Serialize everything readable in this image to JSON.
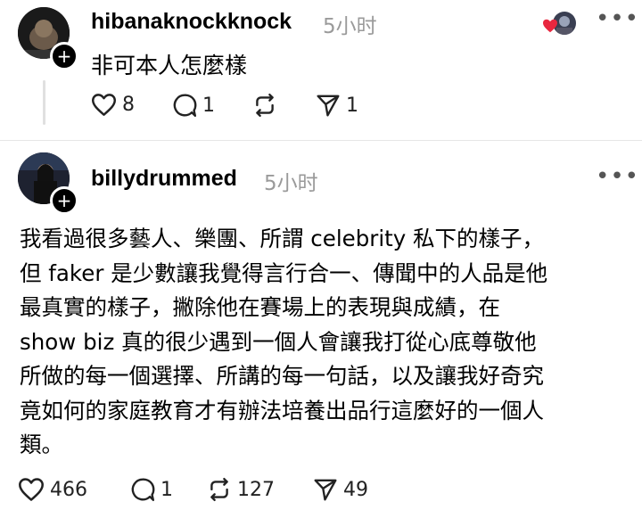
{
  "post1": {
    "username": "hibanaknockknock",
    "time": "5小时",
    "text": "非可本人怎麼樣",
    "likes": "8",
    "replies": "1",
    "reposts": "",
    "shares": "1",
    "more_icon": "more-icon"
  },
  "post2": {
    "username": "billydrummed",
    "time": "5小时",
    "text": "我看過很多藝人、樂團、所謂 celebrity 私下的樣子，\n但 faker 是少數讓我覺得言行合一、傳聞中的人品是他\n最真實的樣子，撇除他在賽場上的表現與成績，在\nshow biz 真的很少遇到一個人會讓我打從心底尊敬他\n所做的每一個選擇、所講的每一句話，以及讓我好奇究\n竟如何的家庭教育才有辦法培養出品行這麼好的一個人\n類。",
    "likes": "466",
    "replies": "1",
    "reposts": "127",
    "shares": "49",
    "more_icon": "more-icon"
  },
  "colors": {
    "heart_red": "#e8273f",
    "muted": "#9a9a9a",
    "icon": "#222222"
  }
}
